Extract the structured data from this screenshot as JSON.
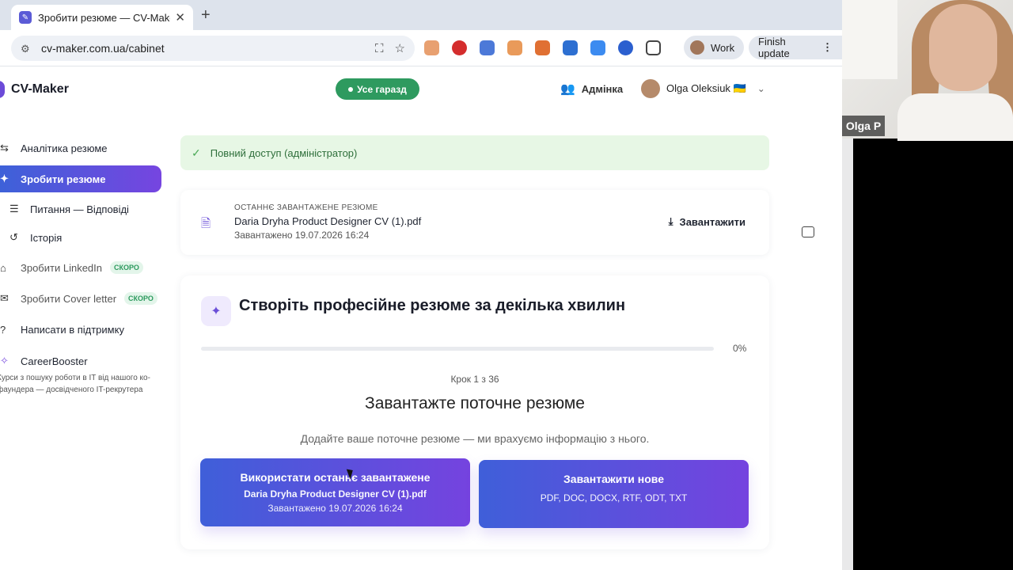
{
  "browser": {
    "tab_title": "Зробити резюме — CV-Maker",
    "url": "cv-maker.com.ua/cabinet",
    "profile_label": "Work",
    "finish_update_label": "Finish update"
  },
  "header": {
    "brand": "CV-Maker",
    "status_pill": "Усе гаразд",
    "admin_label": "Адмінка",
    "user_name": "Olga Oleksiuk 🇺🇦"
  },
  "sidebar": {
    "items": [
      {
        "label": "Аналітика резюме"
      },
      {
        "label": "Зробити резюме"
      },
      {
        "label": "Питання — Відповіді"
      },
      {
        "label": "Історія"
      },
      {
        "label": "Зробити LinkedIn",
        "badge": "СКОРО"
      },
      {
        "label": "Зробити Cover letter",
        "badge": "СКОРО"
      },
      {
        "label": "Написати в підтримку"
      },
      {
        "label": "CareerBooster"
      }
    ],
    "careerbooster_desc": "Курси з пошуку роботи в IT від нашого ко-фаундера — досвідченого IT-рекрутера"
  },
  "main": {
    "access_banner": "Повний доступ (адміністратор)",
    "last_resume": {
      "caption": "ОСТАННЄ ЗАВАНТАЖЕНЕ РЕЗЮМЕ",
      "file_name": "Daria Dryha Product Designer CV (1).pdf",
      "uploaded": "Завантажено 19.07.2026 16:24",
      "download_label": "Завантажити"
    },
    "wizard": {
      "title": "Створіть професійне резюме за декілька хвилин",
      "progress_label": "0%",
      "progress": 0,
      "step": "Крок 1 з 36",
      "heading": "Завантажте поточне резюме",
      "subtitle": "Додайте ваше поточне резюме — ми врахуємо інформацію з нього.",
      "use_last": {
        "title": "Використати останнє завантажене",
        "file": "Daria Dryha Product Designer CV (1).pdf",
        "date": "Завантажено 19.07.2026 16:24"
      },
      "upload_new": {
        "title": "Завантажити нове",
        "formats": "PDF, DOC, DOCX, RTF, ODT, TXT"
      }
    }
  },
  "webcam": {
    "participant_name": "Olga P"
  },
  "colors": {
    "accent_start": "#3f5fd9",
    "accent_end": "#7543df",
    "status_green": "#2e9a5f",
    "banner_bg": "#e7f7e5"
  }
}
